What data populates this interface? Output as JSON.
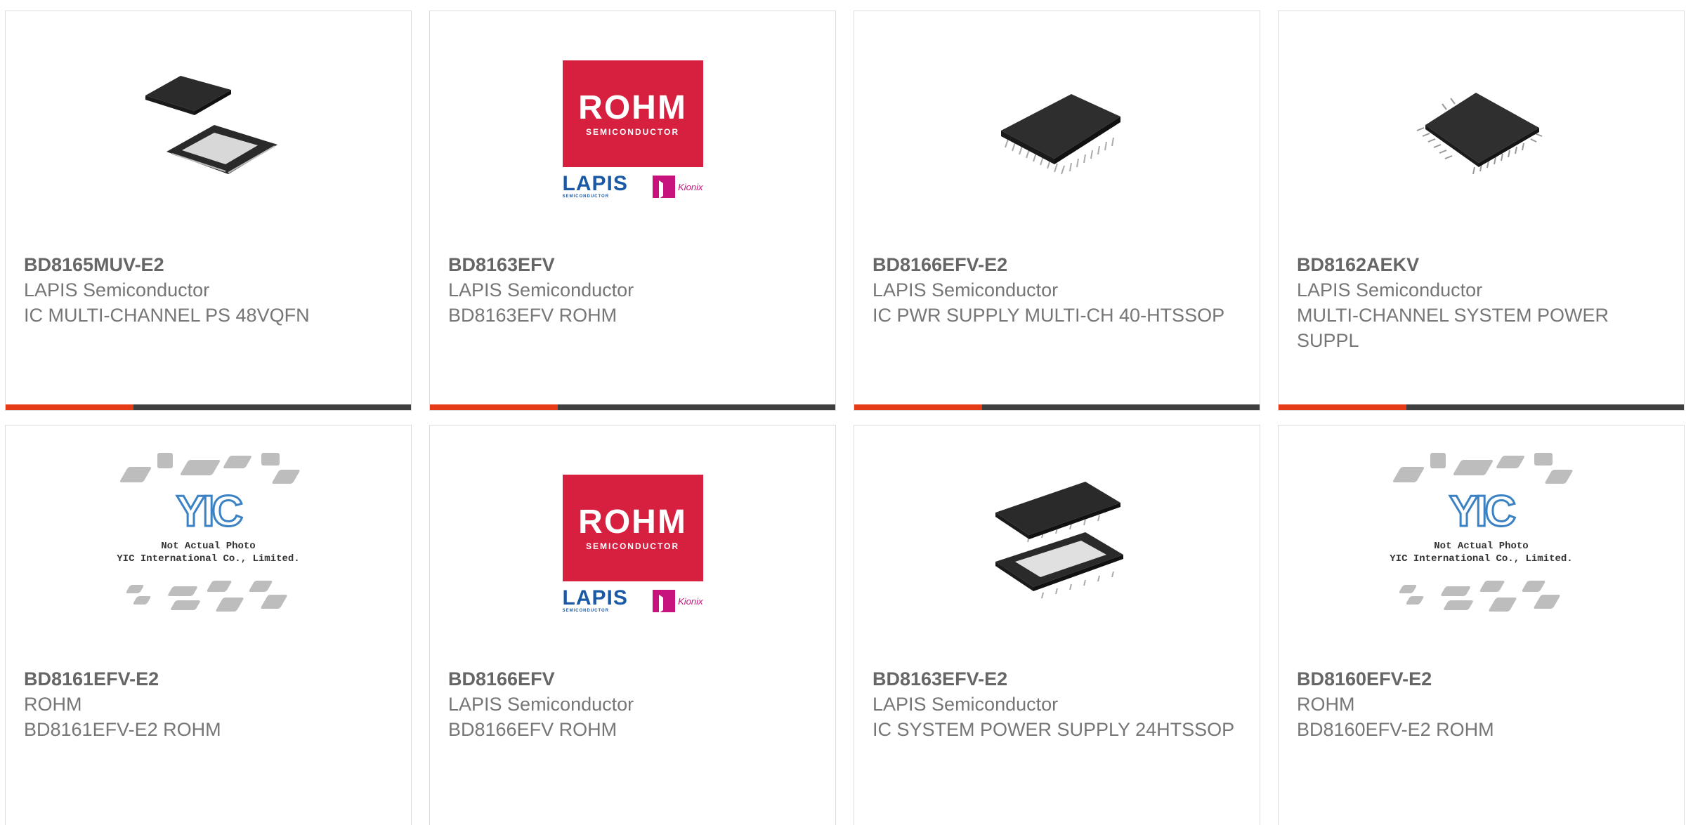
{
  "products": [
    {
      "pn": "BD8165MUV-E2",
      "mfr": "LAPIS Semiconductor",
      "desc": "IC MULTI-CHANNEL PS 48VQFN",
      "image": "qfn-chip-photo"
    },
    {
      "pn": "BD8163EFV",
      "mfr": "LAPIS Semiconductor",
      "desc": "BD8163EFV ROHM",
      "image": "rohm-logo"
    },
    {
      "pn": "BD8166EFV-E2",
      "mfr": "LAPIS Semiconductor",
      "desc": "IC PWR SUPPLY MULTI-CH 40-HTSSOP",
      "image": "htssop-chip-photo"
    },
    {
      "pn": "BD8162AEKV",
      "mfr": "LAPIS Semiconductor",
      "desc": "MULTI-CHANNEL SYSTEM POWER SUPPL",
      "image": "qfp-chip-photo"
    },
    {
      "pn": "BD8161EFV-E2",
      "mfr": "ROHM",
      "desc": "BD8161EFV-E2 ROHM",
      "image": "yic-placeholder"
    },
    {
      "pn": "BD8166EFV",
      "mfr": "LAPIS Semiconductor",
      "desc": "BD8166EFV ROHM",
      "image": "rohm-logo"
    },
    {
      "pn": "BD8163EFV-E2",
      "mfr": "LAPIS Semiconductor",
      "desc": "IC SYSTEM POWER SUPPLY 24HTSSOP",
      "image": "tssop-chip-photo"
    },
    {
      "pn": "BD8160EFV-E2",
      "mfr": "ROHM",
      "desc": "BD8160EFV-E2 ROHM",
      "image": "yic-placeholder"
    }
  ],
  "rohm_logo": {
    "word": "ROHM",
    "sub": "SEMICONDUCTOR",
    "lapis": "LAPIS",
    "lapis_sub": "SEMICONDUCTOR",
    "kionix": "Kionix"
  },
  "yic_logo": {
    "letters": "YIC",
    "note_line1": "Not Actual Photo",
    "note_line2": "YIC International Co., Limited."
  },
  "colors": {
    "accent": "#e63b17",
    "bar": "#3f3f3f",
    "rohm_red": "#d71f3f",
    "lapis_blue": "#1a59a6",
    "kionix_magenta": "#c8137c"
  }
}
